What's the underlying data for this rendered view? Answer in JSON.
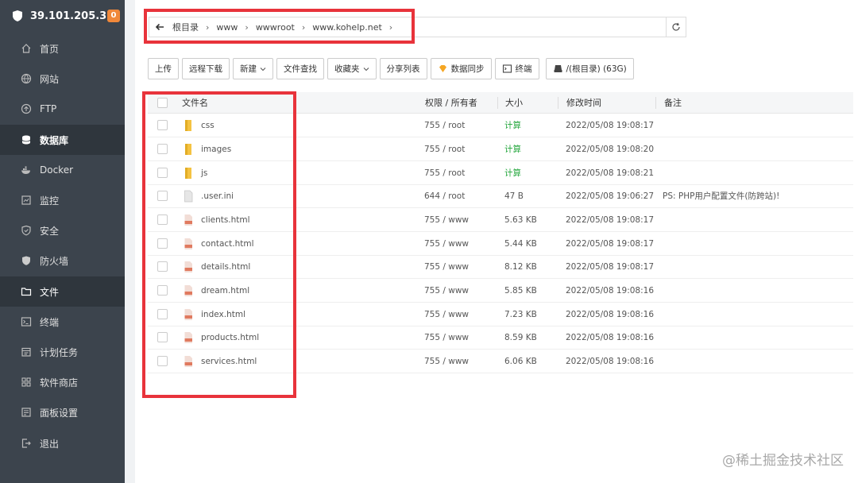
{
  "sidebar": {
    "server_ip": "39.101.205.39",
    "badge": "0",
    "items": [
      {
        "label": "首页",
        "icon": "home-icon"
      },
      {
        "label": "网站",
        "icon": "globe-icon"
      },
      {
        "label": "FTP",
        "icon": "ftp-icon"
      },
      {
        "label": "数据库",
        "icon": "database-icon"
      },
      {
        "label": "Docker",
        "icon": "docker-icon"
      },
      {
        "label": "监控",
        "icon": "monitor-icon"
      },
      {
        "label": "安全",
        "icon": "security-icon"
      },
      {
        "label": "防火墙",
        "icon": "firewall-icon"
      },
      {
        "label": "文件",
        "icon": "folder-icon"
      },
      {
        "label": "终端",
        "icon": "terminal-icon"
      },
      {
        "label": "计划任务",
        "icon": "calendar-icon"
      },
      {
        "label": "软件商店",
        "icon": "apps-icon"
      },
      {
        "label": "面板设置",
        "icon": "settings-icon"
      },
      {
        "label": "退出",
        "icon": "logout-icon"
      }
    ]
  },
  "path": {
    "crumbs": [
      "根目录",
      "www",
      "wwwroot",
      "www.kohelp.net"
    ]
  },
  "toolbar": {
    "upload": "上传",
    "remote_download": "远程下载",
    "new": "新建",
    "file_search": "文件查找",
    "favorites": "收藏夹",
    "share_list": "分享列表",
    "data_sync": "数据同步",
    "terminal": "终端",
    "disk": "/(根目录) (63G)"
  },
  "table": {
    "headers": {
      "name": "文件名",
      "perm": "权限 / 所有者",
      "size": "大小",
      "mtime": "修改时间",
      "note": "备注"
    },
    "rows": [
      {
        "name": "css",
        "type": "folder",
        "perm": "755 / root",
        "size": "计算",
        "mtime": "2022/05/08 19:08:17",
        "note": ""
      },
      {
        "name": "images",
        "type": "folder",
        "perm": "755 / root",
        "size": "计算",
        "mtime": "2022/05/08 19:08:20",
        "note": ""
      },
      {
        "name": "js",
        "type": "folder",
        "perm": "755 / root",
        "size": "计算",
        "mtime": "2022/05/08 19:08:21",
        "note": ""
      },
      {
        "name": ".user.ini",
        "type": "file",
        "perm": "644 / root",
        "size": "47 B",
        "mtime": "2022/05/08 19:06:27",
        "note": "PS: PHP用户配置文件(防跨站)!"
      },
      {
        "name": "clients.html",
        "type": "html",
        "perm": "755 / www",
        "size": "5.63 KB",
        "mtime": "2022/05/08 19:08:17",
        "note": ""
      },
      {
        "name": "contact.html",
        "type": "html",
        "perm": "755 / www",
        "size": "5.44 KB",
        "mtime": "2022/05/08 19:08:17",
        "note": ""
      },
      {
        "name": "details.html",
        "type": "html",
        "perm": "755 / www",
        "size": "8.12 KB",
        "mtime": "2022/05/08 19:08:17",
        "note": ""
      },
      {
        "name": "dream.html",
        "type": "html",
        "perm": "755 / www",
        "size": "5.85 KB",
        "mtime": "2022/05/08 19:08:16",
        "note": ""
      },
      {
        "name": "index.html",
        "type": "html",
        "perm": "755 / www",
        "size": "7.23 KB",
        "mtime": "2022/05/08 19:08:16",
        "note": ""
      },
      {
        "name": "products.html",
        "type": "html",
        "perm": "755 / www",
        "size": "8.59 KB",
        "mtime": "2022/05/08 19:08:16",
        "note": ""
      },
      {
        "name": "services.html",
        "type": "html",
        "perm": "755 / www",
        "size": "6.06 KB",
        "mtime": "2022/05/08 19:08:16",
        "note": ""
      }
    ]
  },
  "watermark": "@稀土掘金技术社区",
  "colors": {
    "sidebar_bg": "#3c444d",
    "highlight": "#e8333b",
    "green": "#20a53a",
    "folder": "#f5c342",
    "html_icon": "#e07a5f"
  }
}
